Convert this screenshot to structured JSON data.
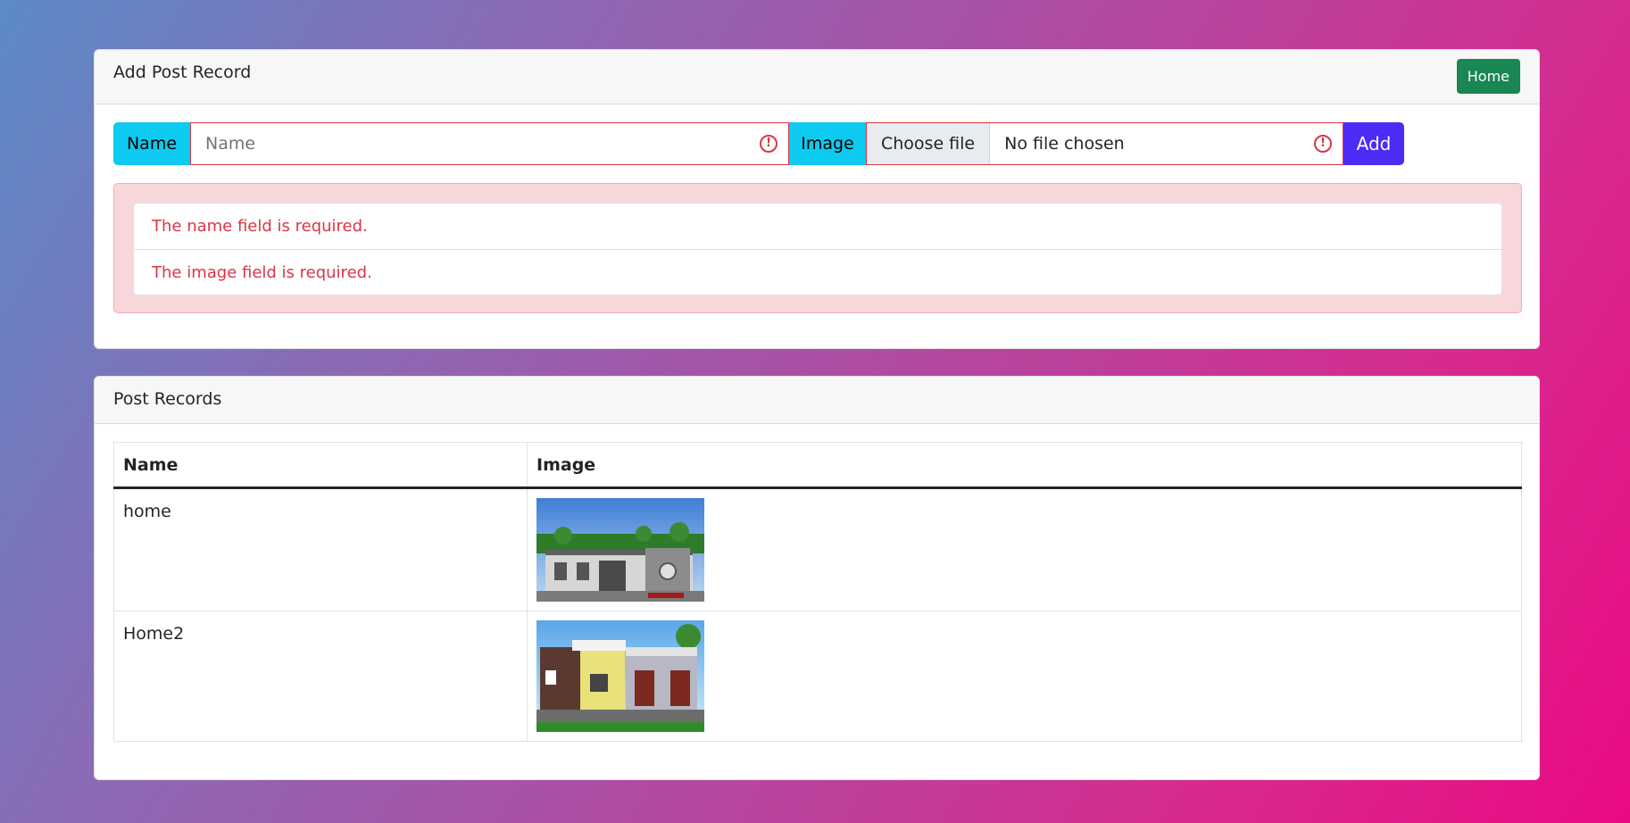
{
  "add_card": {
    "title": "Add Post Record",
    "home_label": "Home",
    "name_addon": "Name",
    "name_placeholder": "Name",
    "name_value": "",
    "image_addon": "Image",
    "choose_file_label": "Choose file",
    "file_status": "No file chosen",
    "add_label": "Add",
    "errors": [
      "The name field is required.",
      "The image field is required."
    ]
  },
  "records_card": {
    "title": "Post Records",
    "columns": [
      "Name",
      "Image"
    ],
    "rows": [
      {
        "name": "home"
      },
      {
        "name": "Home2"
      }
    ]
  },
  "colors": {
    "addon": "#0dcaf0",
    "home_button": "#198754",
    "add_button": "#4c2bf5",
    "error": "#dc3545",
    "alert_bg": "#f8d7da"
  }
}
